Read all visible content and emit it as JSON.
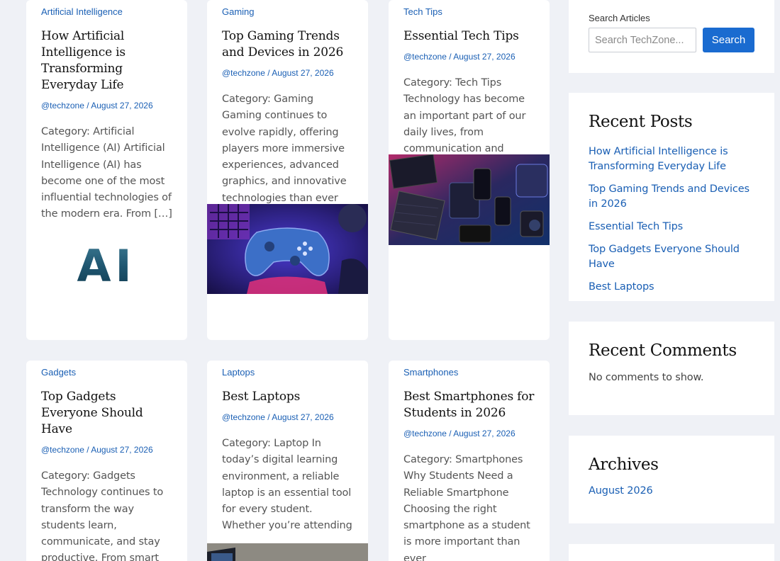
{
  "posts": [
    {
      "category": "Artificial Intelligence",
      "title": "How Artificial Intelligence is Transforming Everyday Life",
      "meta": "@techzone / August 27, 2026",
      "excerpt": "Category: Artificial Intelligence (AI) Artificial Intelligence (AI) has become one of the most influential technologies of the modern era. From […]",
      "image_text": "AI"
    },
    {
      "category": "Gaming",
      "title": "Top Gaming Trends and Devices in 2026",
      "meta": "@techzone / August 27, 2026",
      "excerpt": "Category: Gaming Gaming continues to evolve rapidly, offering players more immersive experiences, advanced graphics, and innovative technologies than ever before."
    },
    {
      "category": "Tech Tips",
      "title": "Essential Tech Tips",
      "meta": "@techzone / August 27, 2026",
      "excerpt": "Category: Tech Tips Technology has become an important part of our daily lives, from communication and education to work and"
    },
    {
      "category": "Gadgets",
      "title": "Top Gadgets Everyone Should Have",
      "meta": "@techzone / August 27, 2026",
      "excerpt": "Category: Gadgets Technology continues to transform the way students learn, communicate, and stay productive. From smart devices that help with"
    },
    {
      "category": "Laptops",
      "title": "Best Laptops",
      "meta": "@techzone / August 27, 2026",
      "excerpt": "Category: Laptop In today’s digital learning environment, a reliable laptop is an essential tool for every student. Whether you’re attending"
    },
    {
      "category": "Smartphones",
      "title": "Best Smartphones for Students in 2026",
      "meta": "@techzone / August 27, 2026",
      "excerpt": "Category: Smartphones Why Students Need a Reliable Smartphone Choosing the right smartphone as a student is more important than ever"
    }
  ],
  "sidebar": {
    "search": {
      "label": "Search Articles",
      "placeholder": "Search TechZone...",
      "button": "Search"
    },
    "recent_posts": {
      "title": "Recent Posts",
      "items": [
        "How Artificial Intelligence is Transforming Everyday Life",
        "Top Gaming Trends and Devices in 2026",
        "Essential Tech Tips",
        "Top Gadgets Everyone Should Have",
        "Best Laptops"
      ]
    },
    "recent_comments": {
      "title": "Recent Comments",
      "text": "No comments to show."
    },
    "archives": {
      "title": "Archives",
      "items": [
        "August 2026"
      ]
    }
  },
  "colors": {
    "background": "#eff1f6",
    "link": "#1a5fb4",
    "button": "#1a6bd0"
  }
}
